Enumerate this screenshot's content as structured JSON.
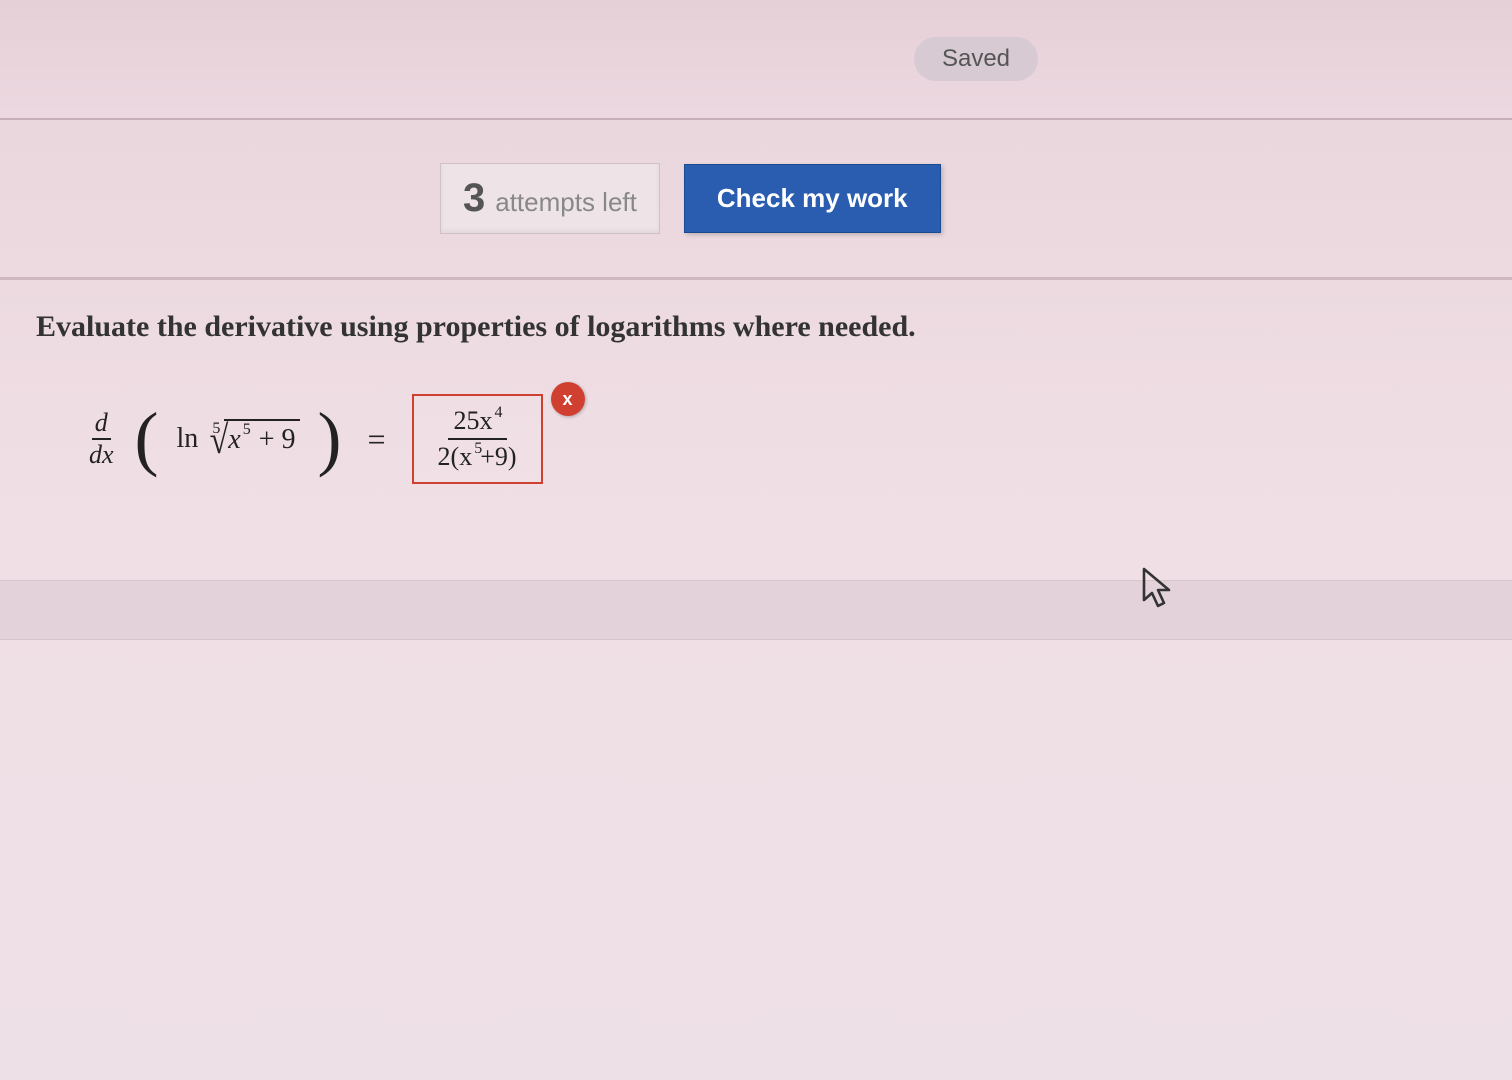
{
  "header": {
    "saved_label": "Saved"
  },
  "toolbar": {
    "attempts_number": "3",
    "attempts_label": "attempts left",
    "check_label": "Check my work"
  },
  "question": {
    "prompt": "Evaluate the derivative using properties of logarithms where needed.",
    "expression": {
      "operator_num": "d",
      "operator_den": "dx",
      "ln": "ln",
      "root_index": "5",
      "radicand_base": "x",
      "radicand_exp": "5",
      "plus_const": "+ 9",
      "equals": "="
    },
    "answer": {
      "numerator_coef": "25x",
      "numerator_exp": "4",
      "denominator_lead": "2(x",
      "denominator_exp": "5",
      "denominator_tail": "+9)"
    },
    "feedback_icon": "x",
    "status": "incorrect"
  }
}
